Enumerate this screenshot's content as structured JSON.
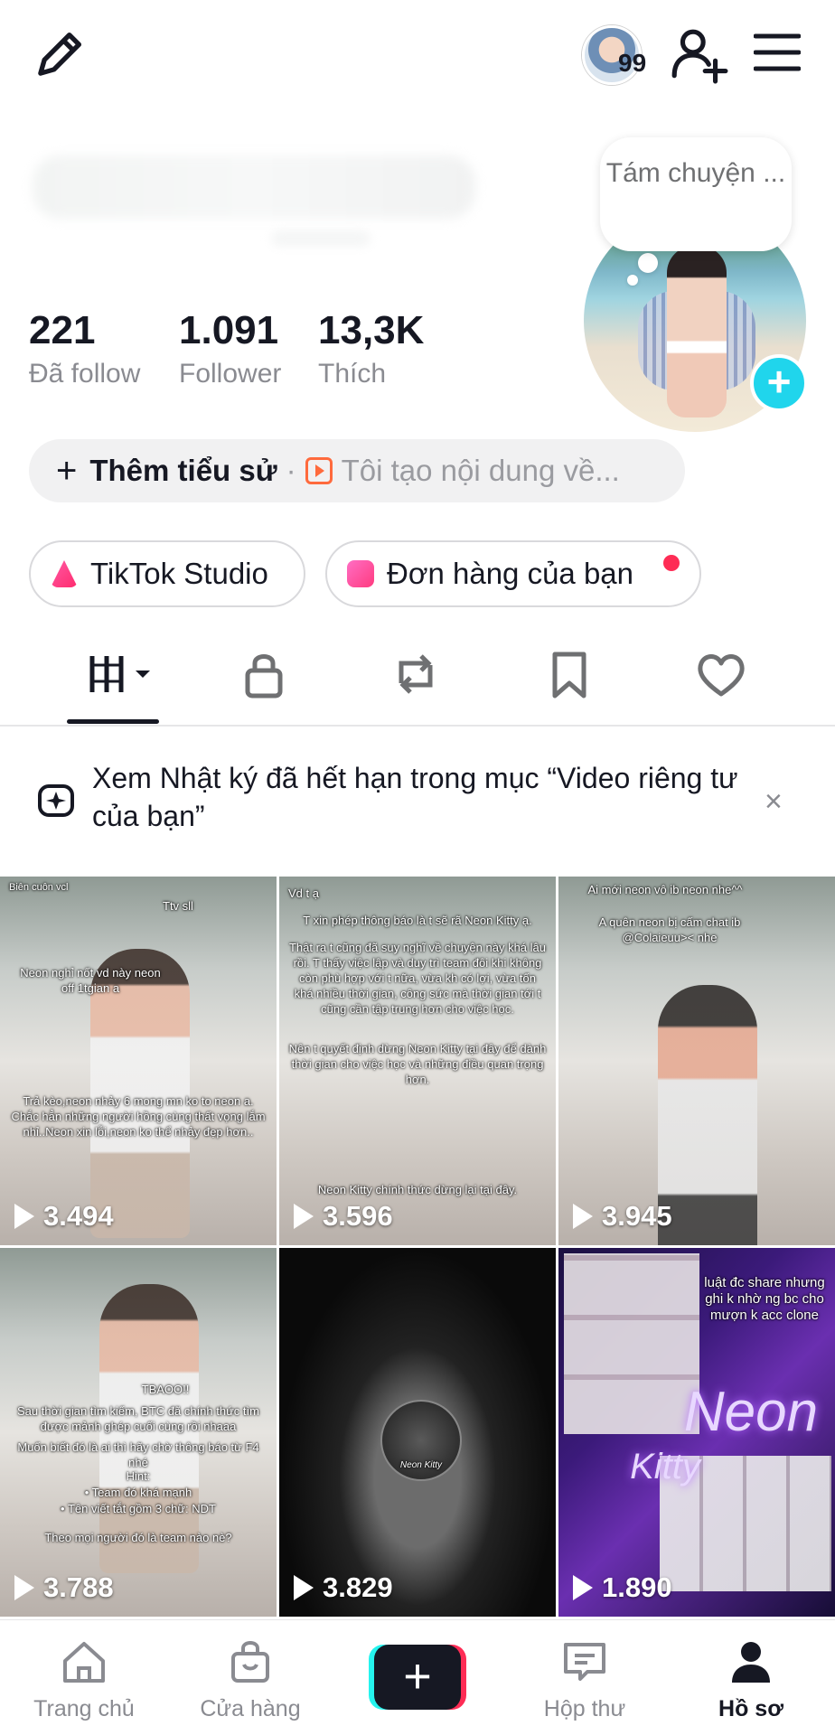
{
  "header": {
    "story_count": "99"
  },
  "profile": {
    "bubble_text": "Tám chuyện ...",
    "stats": [
      {
        "value": "221",
        "label": "Đã follow"
      },
      {
        "value": "1.091",
        "label": "Follower"
      },
      {
        "value": "13,3K",
        "label": "Thích"
      }
    ],
    "bio_add_label": "Thêm tiểu sử",
    "bio_separator": "·",
    "bio_hint": "Tôi tạo nội dung về...",
    "chips": {
      "studio": "TikTok Studio",
      "orders": "Đơn hàng của bạn"
    }
  },
  "notice": {
    "text": "Xem Nhật ký đã hết hạn trong mục “Video riêng tư của bạn”",
    "close": "×"
  },
  "videos": [
    {
      "views": "3.494",
      "captions": [
        "Biên cuôn vcl",
        "Ttv sll",
        "Neon nghỉ nốt vd này neon off 1tgian a",
        "Trả kèo,neon nhảy 6 mong mn ko to neon a. Chắc hẳn những người hồng cùng thất vọng lắm nhỉ..Neon xin lỗi,neon ko thể nhảy đẹp hơn.."
      ]
    },
    {
      "views": "3.596",
      "captions": [
        "Vd t ạ",
        "T xin phép thông báo là t sẽ rã Neon Kitty ạ.",
        "Thật ra t cũng đã suy nghĩ về chuyện này khá lâu rồi. T thấy việc lập và duy trì team đôi khi không còn phù hợp với t nữa, vừa kh có lợi, vừa tốn khá nhiều thời gian, công sức mà thời gian tới t cũng cần tập trung hơn cho việc học.",
        "Nên t quyết định dừng Neon Kitty tại đây để dành thời gian cho việc học và những điều quan trọng hơn.",
        "Neon Kitty chính thức dừng lại tại đây."
      ]
    },
    {
      "views": "3.945",
      "captions": [
        "Ai mới neon vô ib neon nhe^^",
        "A quên neon bị cấm chat ib @Colaieuu><  nhe"
      ]
    },
    {
      "views": "3.788",
      "captions": [
        "TBAOO!!",
        "Sau thời gian tìm kiếm, BTC đã chính thức tìm được mảnh ghép cuối cùng rồi nhaaa",
        "Muốn biết đó là ai thì hãy chờ thông báo từ F4 nhé",
        "Hint:",
        "• Team đó khá mạnh",
        "• Tên viết tắt gồm 3 chữ: NDT",
        "Theo mọi người đó là team nào nè?"
      ]
    },
    {
      "views": "3.829",
      "captions": [
        "Neon Kitty"
      ]
    },
    {
      "views": "1.890",
      "captions": [
        "luật đc share nhưng ghi k nhờ ng bc cho mượn k acc clone",
        "Neon",
        "Kitty"
      ]
    }
  ],
  "bottom_nav": [
    {
      "label": "Trang chủ"
    },
    {
      "label": "Cửa hàng"
    },
    {
      "label": ""
    },
    {
      "label": "Hộp thư"
    },
    {
      "label": "Hồ sơ"
    }
  ],
  "colors": {
    "accent_cyan": "#20d5ec",
    "accent_red": "#fe2c55",
    "text_primary": "#161823",
    "text_secondary": "#8a8b91"
  },
  "icons": [
    "pencil-icon",
    "add-user-icon",
    "menu-icon",
    "grid-icon",
    "lock-icon",
    "repost-icon",
    "bookmark-icon",
    "heart-icon",
    "home-icon",
    "shop-icon",
    "inbox-icon",
    "profile-icon"
  ]
}
